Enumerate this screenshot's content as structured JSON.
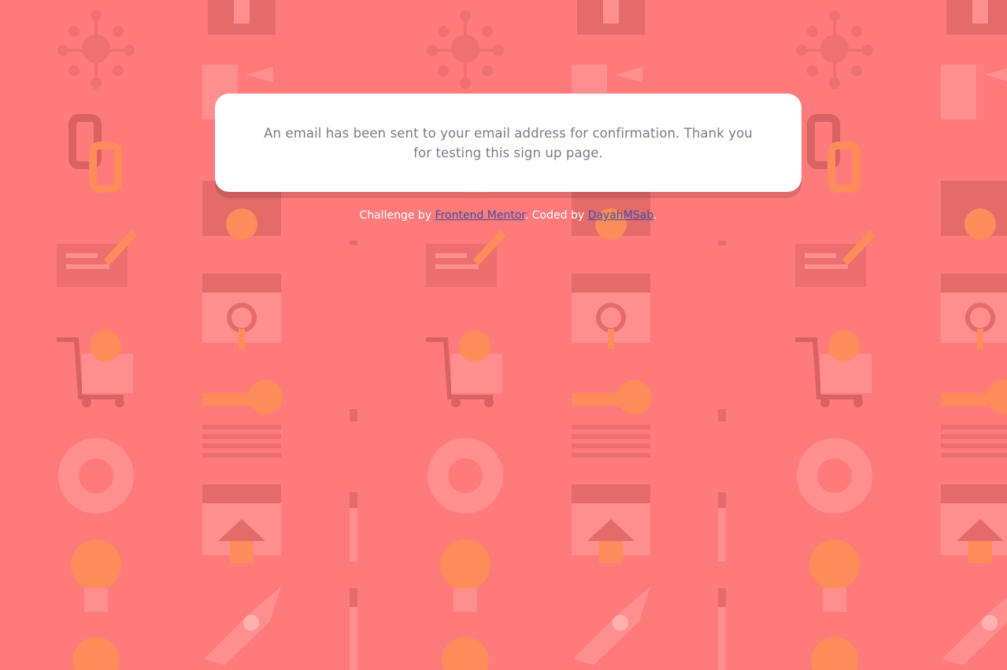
{
  "message": {
    "text": "An email has been sent to your email address for confirmation. Thank you for testing this sign up page."
  },
  "footer": {
    "prefix": "Challenge by ",
    "challenge_link": "Frontend Mentor",
    "middle": ". Coded by ",
    "author_link": "DayahMSab",
    "suffix": "."
  },
  "colors": {
    "background": "#ff7a7a",
    "card": "#ffffff",
    "text": "#7b7b88",
    "link": "#3e52a3"
  },
  "icons": [
    "network-icon",
    "wrench-icon",
    "chain-link-icon",
    "gear-icon",
    "chat-pencil-icon",
    "browser-search-icon",
    "shopping-cart-icon",
    "key-icon",
    "lifebuoy-icon",
    "browser-home-icon",
    "lightbulb-icon",
    "rocket-icon"
  ]
}
